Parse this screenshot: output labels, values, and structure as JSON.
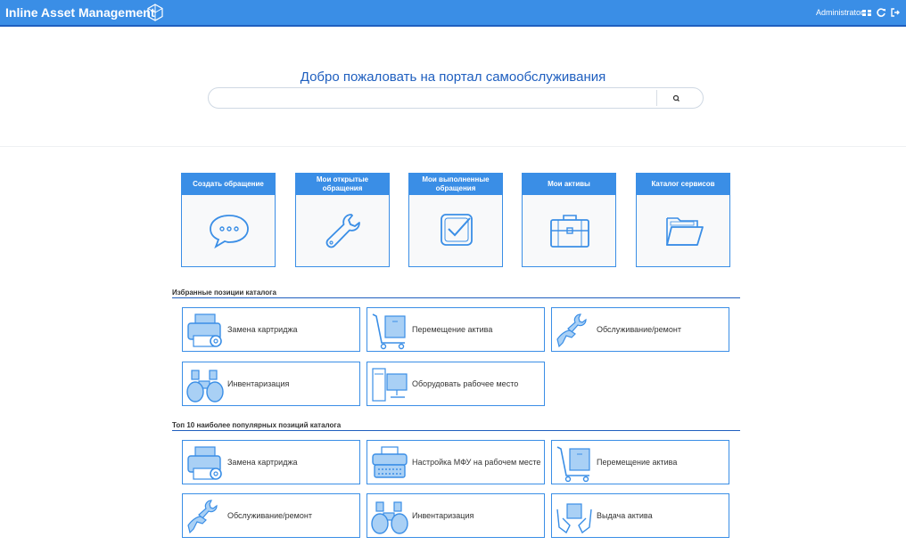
{
  "header": {
    "brand": "Inline Asset Management",
    "user": "Administrator",
    "icons": [
      "grid-icon",
      "refresh-icon",
      "logout-icon"
    ]
  },
  "welcome": {
    "title": "Добро пожаловать на портал самообслуживания",
    "search_value": "",
    "search_placeholder": ""
  },
  "tiles": [
    {
      "label": "Создать обращение",
      "icon": "speech-bubble-icon"
    },
    {
      "label": "Мои открытые обращения",
      "icon": "wrench-icon"
    },
    {
      "label": "Мои выполненные обращения",
      "icon": "checkbox-icon"
    },
    {
      "label": "Мои активы",
      "icon": "briefcase-icon"
    },
    {
      "label": "Каталог сервисов",
      "icon": "folder-icon"
    }
  ],
  "favorites": {
    "title": "Избранные позиции каталога",
    "items": [
      {
        "label": "Замена картриджа",
        "icon": "printer-gear-icon"
      },
      {
        "label": "Перемещение актива",
        "icon": "hand-truck-icon"
      },
      {
        "label": "Обслуживание/ремонт",
        "icon": "hand-wrench-icon"
      },
      {
        "label": "Инвентаризация",
        "icon": "binoculars-icon"
      },
      {
        "label": "Оборудовать рабочее место",
        "icon": "computer-icon"
      }
    ]
  },
  "top10": {
    "title": "Топ 10 наиболее популярных позиций каталога",
    "items": [
      {
        "label": "Замена картриджа",
        "icon": "printer-gear-icon"
      },
      {
        "label": "Настройка МФУ на рабочем месте",
        "icon": "typewriter-icon"
      },
      {
        "label": "Перемещение актива",
        "icon": "hand-truck-icon"
      },
      {
        "label": "Обслуживание/ремонт",
        "icon": "hand-wrench-icon"
      },
      {
        "label": "Инвентаризация",
        "icon": "binoculars-icon"
      },
      {
        "label": "Выдача актива",
        "icon": "hands-box-icon"
      }
    ]
  },
  "colors": {
    "accent": "#3a8ee6",
    "accent_dark": "#1f5fbf",
    "icon_fill": "#a9d0f5"
  }
}
